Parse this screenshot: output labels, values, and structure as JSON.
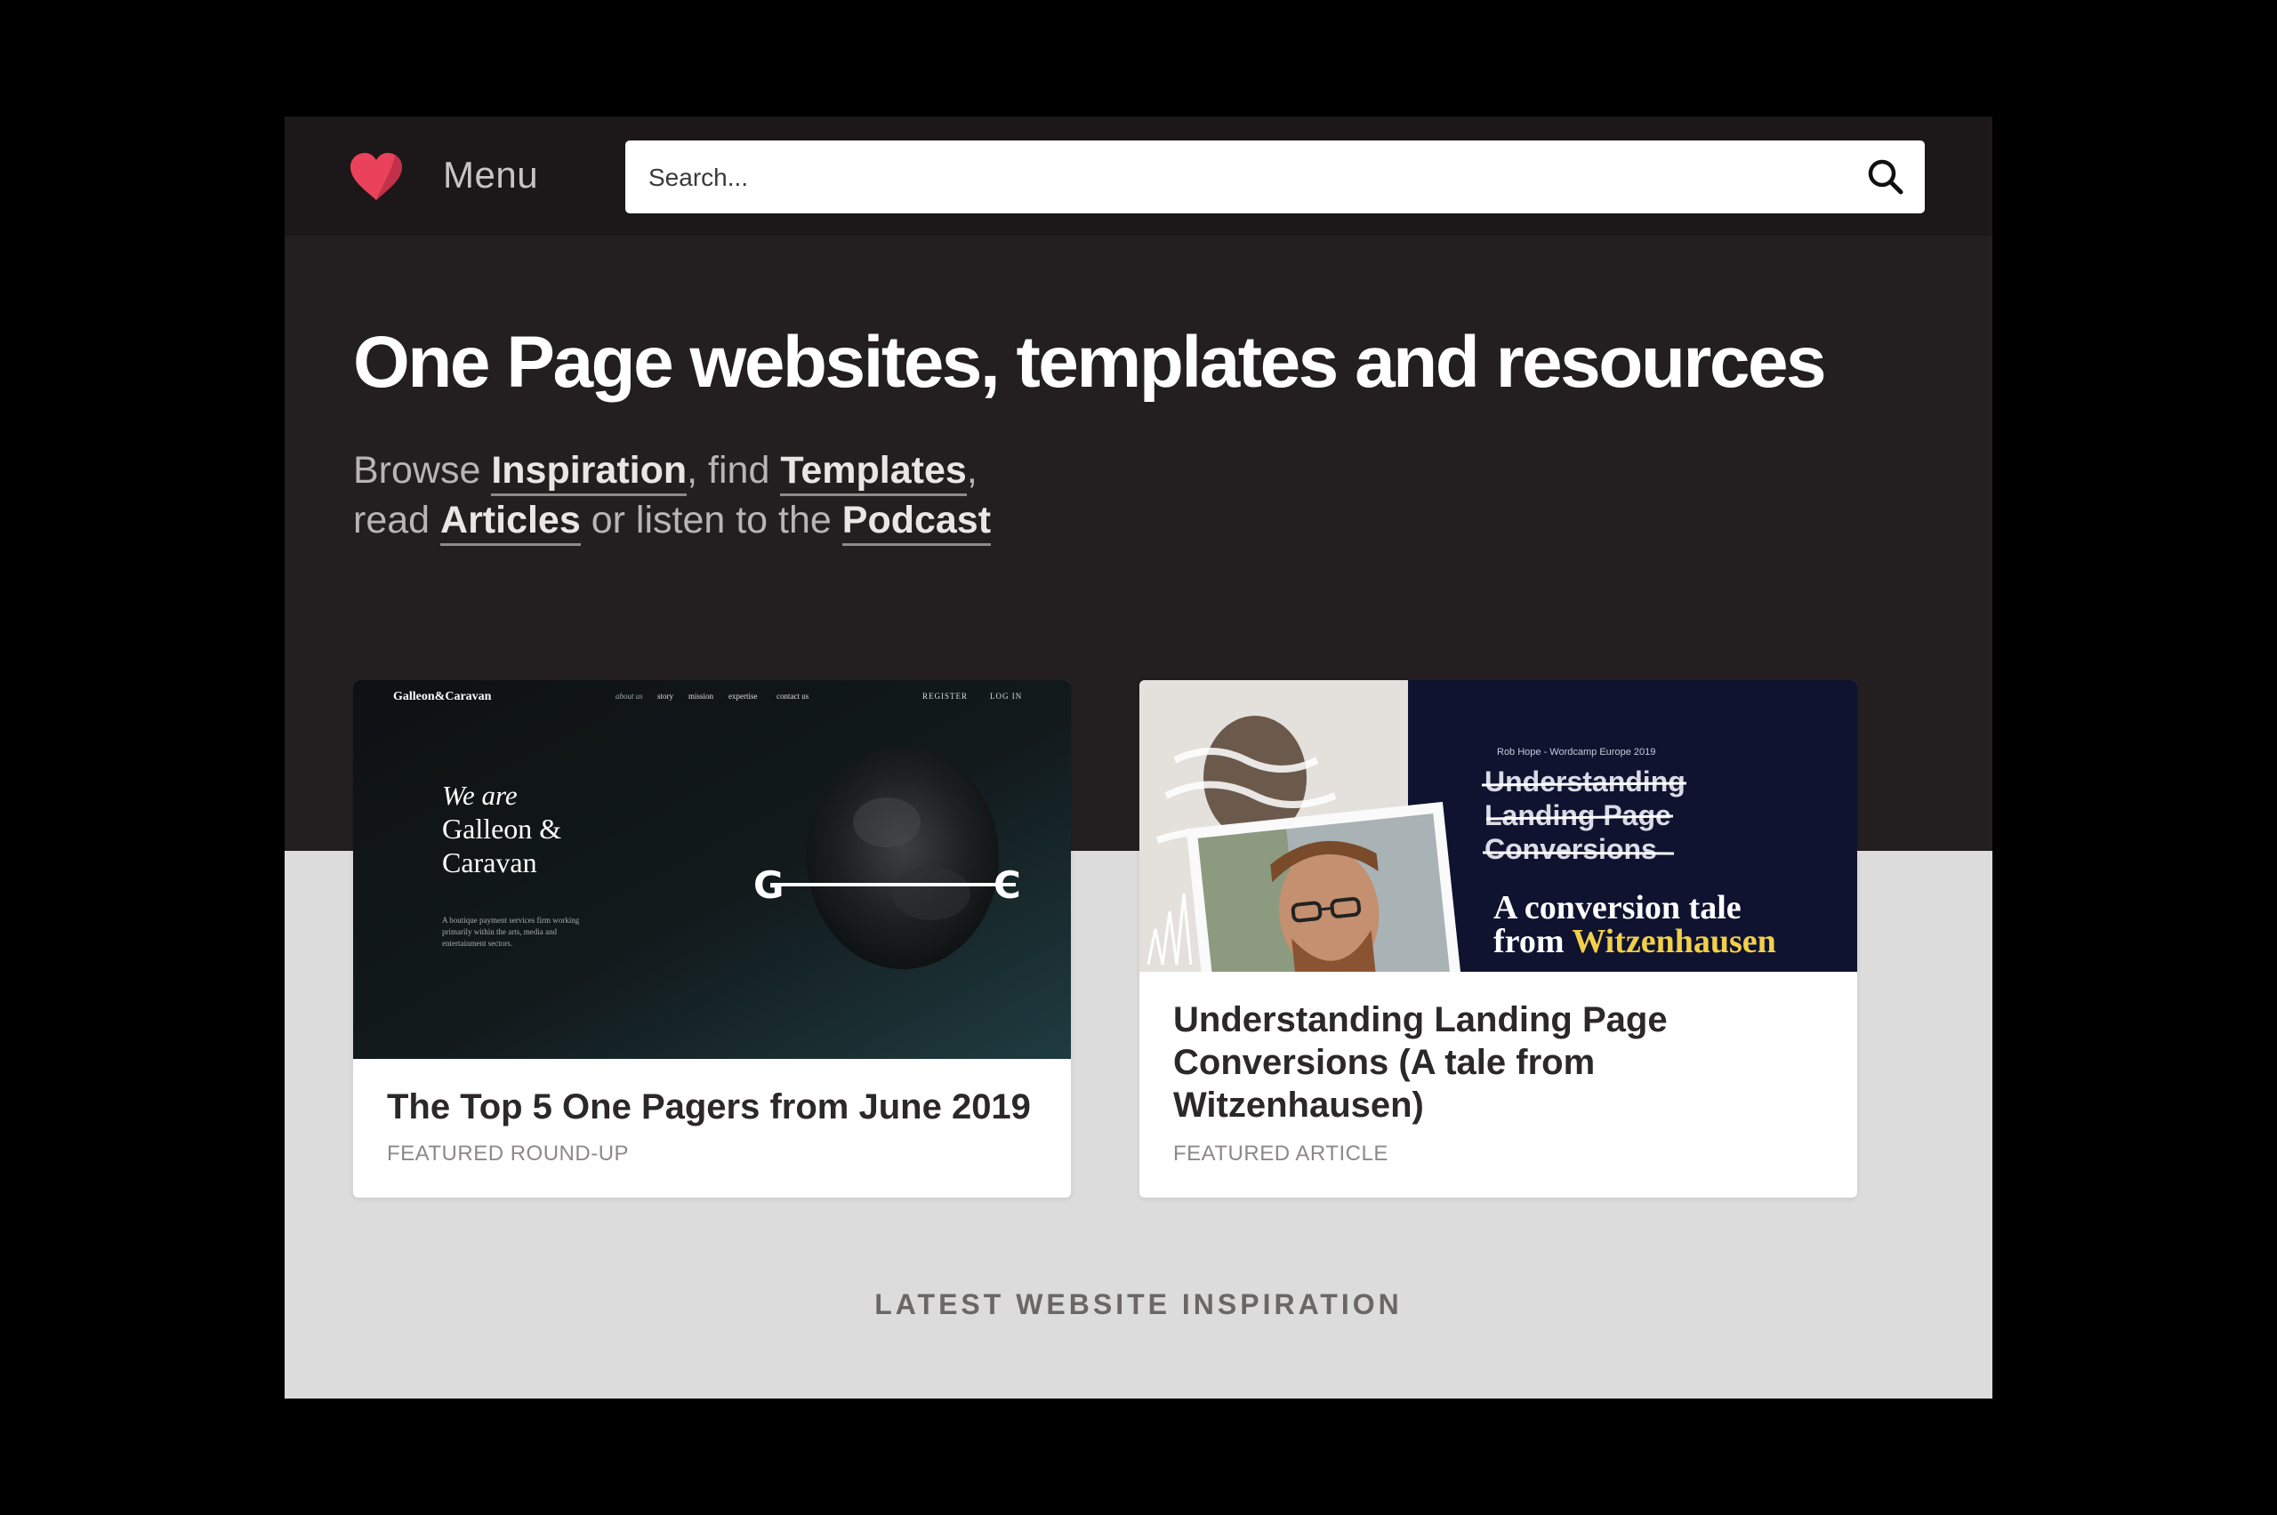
{
  "header": {
    "menu_label": "Menu",
    "search_placeholder": "Search..."
  },
  "hero": {
    "title": "One Page websites, templates and resources",
    "sub_browse": "Browse ",
    "link_inspiration": "Inspiration",
    "sub_find": ", find ",
    "link_templates": "Templates",
    "sub_comma": ",",
    "sub_read": "read ",
    "link_articles": "Articles",
    "sub_listen": " or listen to the ",
    "link_podcast": "Podcast"
  },
  "cards": [
    {
      "title": "The Top 5 One Pagers from June 2019",
      "tag": "FEATURED ROUND-UP",
      "thumb": {
        "brand": "Galleon&Caravan",
        "nav": [
          "about us",
          "story",
          "mission",
          "expertise",
          "contact us"
        ],
        "auth": [
          "REGISTER",
          "LOG IN"
        ],
        "headline": [
          "We are",
          "Galleon &",
          "Caravan"
        ],
        "blurb": [
          "A boutique payment services firm working",
          "primarily within the arts, media and",
          "entertainment sectors."
        ],
        "monogram_left": "G",
        "monogram_right": "C"
      }
    },
    {
      "title": "Understanding Landing Page Conversions (A tale from Witzenhausen)",
      "tag": "FEATURED ARTICLE",
      "thumb": {
        "byline": "Rob Hope - Wordcamp Europe 2019",
        "struck": [
          "Understanding",
          "Landing Page",
          "Conversions"
        ],
        "tagline_1": "A conversion tale",
        "tagline_2_prefix": "from ",
        "tagline_2_highlight": "Witzenhausen"
      }
    }
  ],
  "latest_heading": "LATEST WEBSITE INSPIRATION",
  "colors": {
    "brand_heart": "#e9425a",
    "hero_bg": "#231e1f",
    "body_bg": "#dcdcdc",
    "highlight_yellow": "#f2cf4a"
  }
}
